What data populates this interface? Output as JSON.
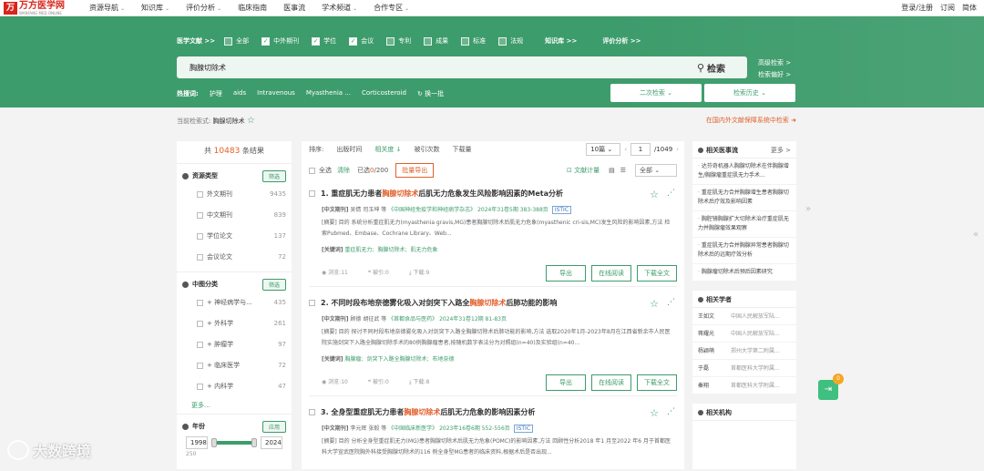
{
  "brand": {
    "name": "万方医学网",
    "sub": "WANFANG MED ONLINE",
    "icon": "万"
  },
  "topnav": {
    "items": [
      "资源导航",
      "知识库",
      "评价分析",
      "临床指南",
      "医事流",
      "学术频道",
      "合作专区"
    ],
    "right": [
      "登录/注册",
      "订阅",
      "简体"
    ]
  },
  "filters": {
    "title": "医学文献 >>",
    "options": [
      {
        "label": "全部",
        "checked": false
      },
      {
        "label": "中外期刊",
        "checked": true
      },
      {
        "label": "学位",
        "checked": true
      },
      {
        "label": "会议",
        "checked": true
      },
      {
        "label": "专利",
        "checked": false
      },
      {
        "label": "成果",
        "checked": false
      },
      {
        "label": "标准",
        "checked": false
      },
      {
        "label": "法规",
        "checked": false
      }
    ],
    "kb": "知识库 >>",
    "eval": "评价分析 >>"
  },
  "search": {
    "value": "胸腺切除术",
    "button": "检索",
    "advanced": "高级检索 >",
    "prefs": "检索偏好 >"
  },
  "hotwords": {
    "label": "热搜词:",
    "words": [
      "护理",
      "aids",
      "Intravenous",
      "Myasthenia ...",
      "Corticosteroid"
    ],
    "refresh": "换一批"
  },
  "secondary_btn": "二次检索",
  "history_btn": "检索历史",
  "current": {
    "label": "当前检索式:",
    "value": "胸腺切除术",
    "right_link": "在国内外文献保障系统中检索"
  },
  "left": {
    "total_prefix": "共",
    "total": "10483",
    "total_suffix": "条结果",
    "resource": {
      "title": "资源类型",
      "btn": "筛选",
      "items": [
        {
          "label": "外文期刊",
          "count": "9435"
        },
        {
          "label": "中文期刊",
          "count": "839"
        },
        {
          "label": "学位论文",
          "count": "137"
        },
        {
          "label": "会议论文",
          "count": "72"
        }
      ]
    },
    "clc": {
      "title": "中图分类",
      "btn": "筛选",
      "items": [
        {
          "label": "神经病学与...",
          "count": "435"
        },
        {
          "label": "外科学",
          "count": "261"
        },
        {
          "label": "肿瘤学",
          "count": "97"
        },
        {
          "label": "临床医学",
          "count": "72"
        },
        {
          "label": "内科学",
          "count": "47"
        }
      ],
      "more": "更多..."
    },
    "year": {
      "title": "年份",
      "btn": "应用",
      "from": "1998",
      "to": "2024",
      "bottom": "250"
    }
  },
  "sort": {
    "label": "排序:",
    "options": [
      "出版时间",
      "相关度 ↓",
      "被引次数",
      "下载量"
    ],
    "active": 1,
    "page_size": "10篇",
    "page": "1",
    "total_pages": "/1049"
  },
  "actions": {
    "select_all": "全选",
    "clear": "清除",
    "selected": "已选",
    "selected_count": "0",
    "selected_total": "/200",
    "export": "批量导出",
    "doc_cite": "文献计量",
    "filter_all": "全部"
  },
  "articles": [
    {
      "num": "1.",
      "title_pre": "重症肌无力患者",
      "title_hl": "胸腺切除术",
      "title_post": "后肌无力危象发生风险影响因素的Meta分析",
      "type": "[中文期刊]",
      "authors": "吴倩 司玉坤 等",
      "source": "《中国神经免疫学和神经病学杂志》",
      "date": "2024年31卷5期 383-388页",
      "badge": "ISTIC",
      "abstract": "[摘要] 目的 系统分析重症肌无力(myasthenia gravis,MG)患者胸腺切除术后肌无力危象(myasthenic cri-sis,MC)发生风险的影响因素,方法 检索Pubmed、Embase、Cochrane Library、Web...",
      "kw_label": "[关键词]",
      "keywords": [
        "重症肌无力;",
        "胸腺切除术;",
        "肌无力危象"
      ],
      "views": "浏览:11",
      "cites": "被引:0",
      "downloads": "下载:9",
      "btn_export": "导出",
      "btn_read": "在线阅读",
      "btn_download": "下载全文"
    },
    {
      "num": "2.",
      "title_pre": "不同时段布地奈德雾化吸入对剑突下入路全",
      "title_hl": "胸腺切除术",
      "title_post": "后肺功能的影响",
      "type": "[中文期刊]",
      "authors": "顾德 胡征武 等",
      "source": "《首都食品与医药》",
      "date": "2024年31卷12期 81-83页",
      "badge": "",
      "abstract": "[摘要] 目的 探讨不同时段布地奈德雾化吸入对剑突下入路全胸腺切除术后肺功能的影响,方法 选取2020年1月-2023年8月在江西省新余市人民医院实施剑突下入路全胸腺切除手术的80例胸腺瘤患者,按随机数字表法分为对照组(n=40)及实验组(n=40...",
      "kw_label": "[关键词]",
      "keywords": [
        "胸腺瘤;",
        "剑突下入路全胸腺切除术;",
        "布地奈德"
      ],
      "views": "浏览:10",
      "cites": "被引:0",
      "downloads": "下载:8",
      "btn_export": "导出",
      "btn_read": "在线阅读",
      "btn_download": "下载全文"
    },
    {
      "num": "3.",
      "title_pre": "全身型重症肌无力患者",
      "title_hl": "胸腺切除术",
      "title_post": "后肌无力危象的影响因素分析",
      "type": "[中文期刊]",
      "authors": "李元辉 张毅 等",
      "source": "《中国临床新医学》",
      "date": "2023年16卷6期 552-556页",
      "badge": "ISTIC",
      "abstract": "[摘要] 目的 分析全身型重症肌无力(MG)患者胸腺切除术后肌无力危象(POMC)的影响因素,方法 回顾性分析2018 年1 月至2022 年6 月于首都医科大学宣武医院胸外科接受胸腺切除术的116 例全身型MG患者的临床资料,根据术后是否出现...",
      "kw_label": "",
      "keywords": [],
      "views": "",
      "cites": "",
      "downloads": "",
      "btn_export": "",
      "btn_read": "",
      "btn_download": ""
    }
  ],
  "right": {
    "news": {
      "title": "相关医事流",
      "more": "更多 >",
      "items": [
        "达芬奇机器人胸腺切除术在伴胸腺增生/胸腺瘤重症肌无力手术...",
        "重症肌无力合并胸腺增生患者胸腺切除术后疗效及影响因素",
        "胸腔镜胸腺扩大切除术治疗重症肌无力并胸腺瘤效果观察",
        "重症肌无力合并胸腺异常患者胸腺切除术后的远期疗效分析",
        "胸腺瘤切除术后预后因素研究"
      ]
    },
    "scholars": {
      "title": "相关学者",
      "items": [
        {
          "name": "王如文",
          "org": "中国人民解放军陆..."
        },
        {
          "name": "蒋耀光",
          "org": "中国人民解放军陆..."
        },
        {
          "name": "杨颖萌",
          "org": "郑州大学第二附属..."
        },
        {
          "name": "于磊",
          "org": "首都医科大学附属..."
        },
        {
          "name": "秦翔",
          "org": "首都医科大学附属..."
        }
      ]
    },
    "orgs": {
      "title": "相关机构"
    }
  },
  "floating": {
    "badge": "0"
  },
  "watermark": "大数跨境"
}
